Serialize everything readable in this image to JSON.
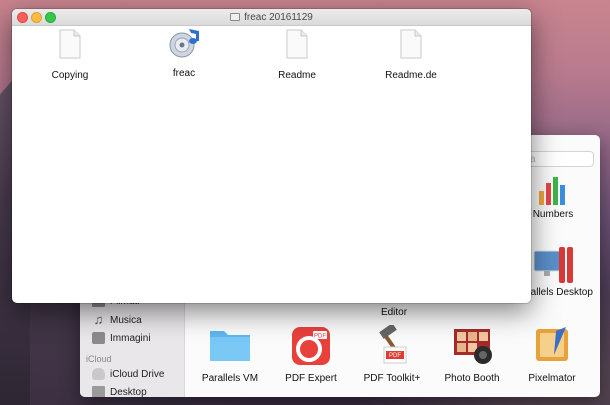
{
  "front_window": {
    "title": "freac 20161129",
    "files": [
      {
        "name": "Copying",
        "icon": "document-icon"
      },
      {
        "name": "freac",
        "icon": "freac-app-icon"
      },
      {
        "name": "Readme",
        "icon": "document-icon"
      },
      {
        "name": "Readme.de",
        "icon": "document-icon"
      }
    ]
  },
  "back_window": {
    "search_placeholder": "ca",
    "sidebar": {
      "items": [
        {
          "label": "Filmati",
          "icon": "film-icon"
        },
        {
          "label": "Musica",
          "icon": "music-icon"
        },
        {
          "label": "Immagini",
          "icon": "camera-icon"
        }
      ],
      "section_icloud": "iCloud",
      "icloud_items": [
        {
          "label": "iCloud Drive",
          "icon": "cloud-icon"
        },
        {
          "label": "Desktop",
          "icon": "desktop-icon"
        }
      ]
    },
    "apps_top": [
      {
        "name": "Numbers",
        "icon": "numbers-icon"
      },
      {
        "name": "Editor",
        "icon": ""
      },
      {
        "name": "Parallels Desktop",
        "icon": "parallels-desktop-icon"
      }
    ],
    "apps_bottom": [
      {
        "name": "Parallels VM",
        "icon": "folder-icon"
      },
      {
        "name": "PDF Expert",
        "icon": "pdf-expert-icon"
      },
      {
        "name": "PDF Toolkit+",
        "icon": "pdf-toolkit-icon"
      },
      {
        "name": "Photo Booth",
        "icon": "photo-booth-icon"
      },
      {
        "name": "Pixelmator",
        "icon": "pixelmator-icon"
      }
    ]
  }
}
